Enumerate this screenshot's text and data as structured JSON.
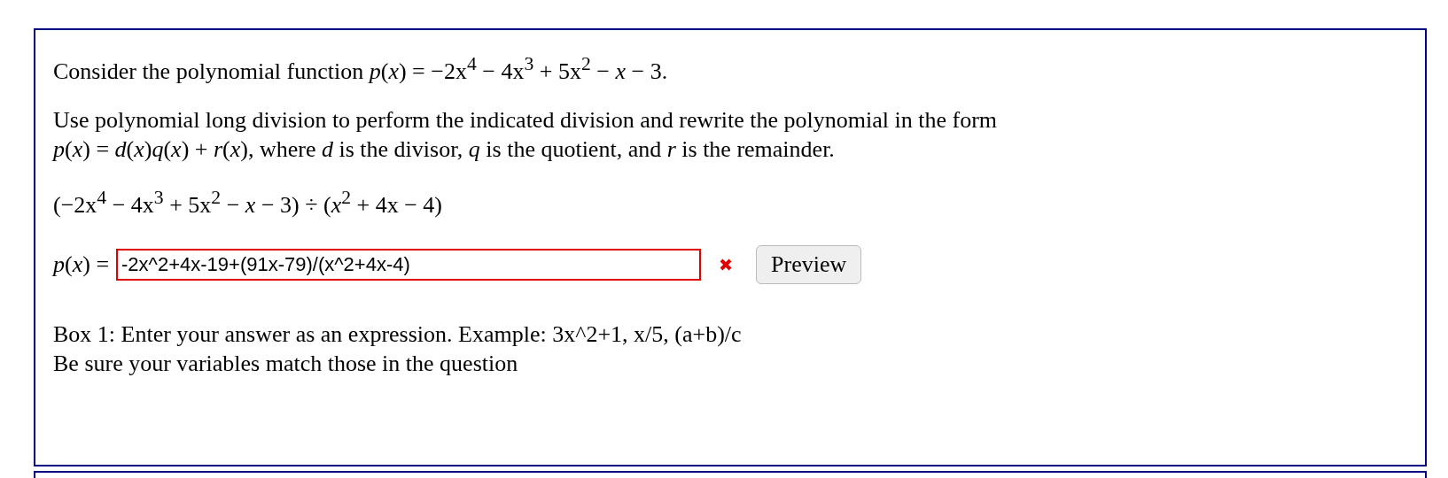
{
  "question": {
    "intro": "Consider the polynomial function *p*(*x*) = −2x$^{4}$ − 4x$^{3}$ + 5x$^{2}$ − *x* − 3.",
    "instruction": "Use polynomial long division to perform the indicated division and rewrite the polynomial in the form\n*p*(*x*) = *d*(*x*)*q*(*x*) + *r*(*x*), where *d* is the divisor, *q* is the quotient, and *r* is the remainder.",
    "division": "(−2x$^{4}$ − 4x$^{3}$ + 5x$^{2}$ − *x* − 3) ÷ (*x*$^{2}$ + 4x − 4)"
  },
  "answer": {
    "label": "*p*(*x*) =",
    "value": "-2x^2+4x-19+(91x-79)/(x^2+4x-4)",
    "correct": false
  },
  "preview_button": "Preview",
  "hints": [
    "Box 1: Enter your answer as an expression. Example: 3x^2+1, x/5, (a+b)/c",
    "Be sure your variables match those in the question"
  ]
}
